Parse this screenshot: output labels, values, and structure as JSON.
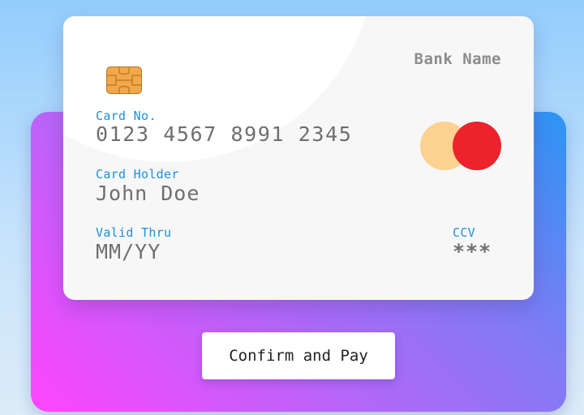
{
  "card": {
    "bank_name": "Bank Name",
    "chip_icon": "sim-chip-icon",
    "number_label": "Card No.",
    "number_value": "0123 4567 8991 2345",
    "holder_label": "Card Holder",
    "holder_value": "John Doe",
    "valid_label": "Valid Thru",
    "valid_value": "MM/YY",
    "ccv_label": "CCV",
    "ccv_value": "***",
    "brand_logo_icon": "mastercard-logo-icon"
  },
  "actions": {
    "confirm_label": "Confirm and Pay"
  },
  "colors": {
    "label_blue": "#1e8fe0",
    "value_gray": "#6f6f6f",
    "panel_gradient_start": "#ff45ff",
    "panel_gradient_end": "#2b95f4",
    "logo_left": "#fdd18f",
    "logo_right": "#ec222c"
  }
}
